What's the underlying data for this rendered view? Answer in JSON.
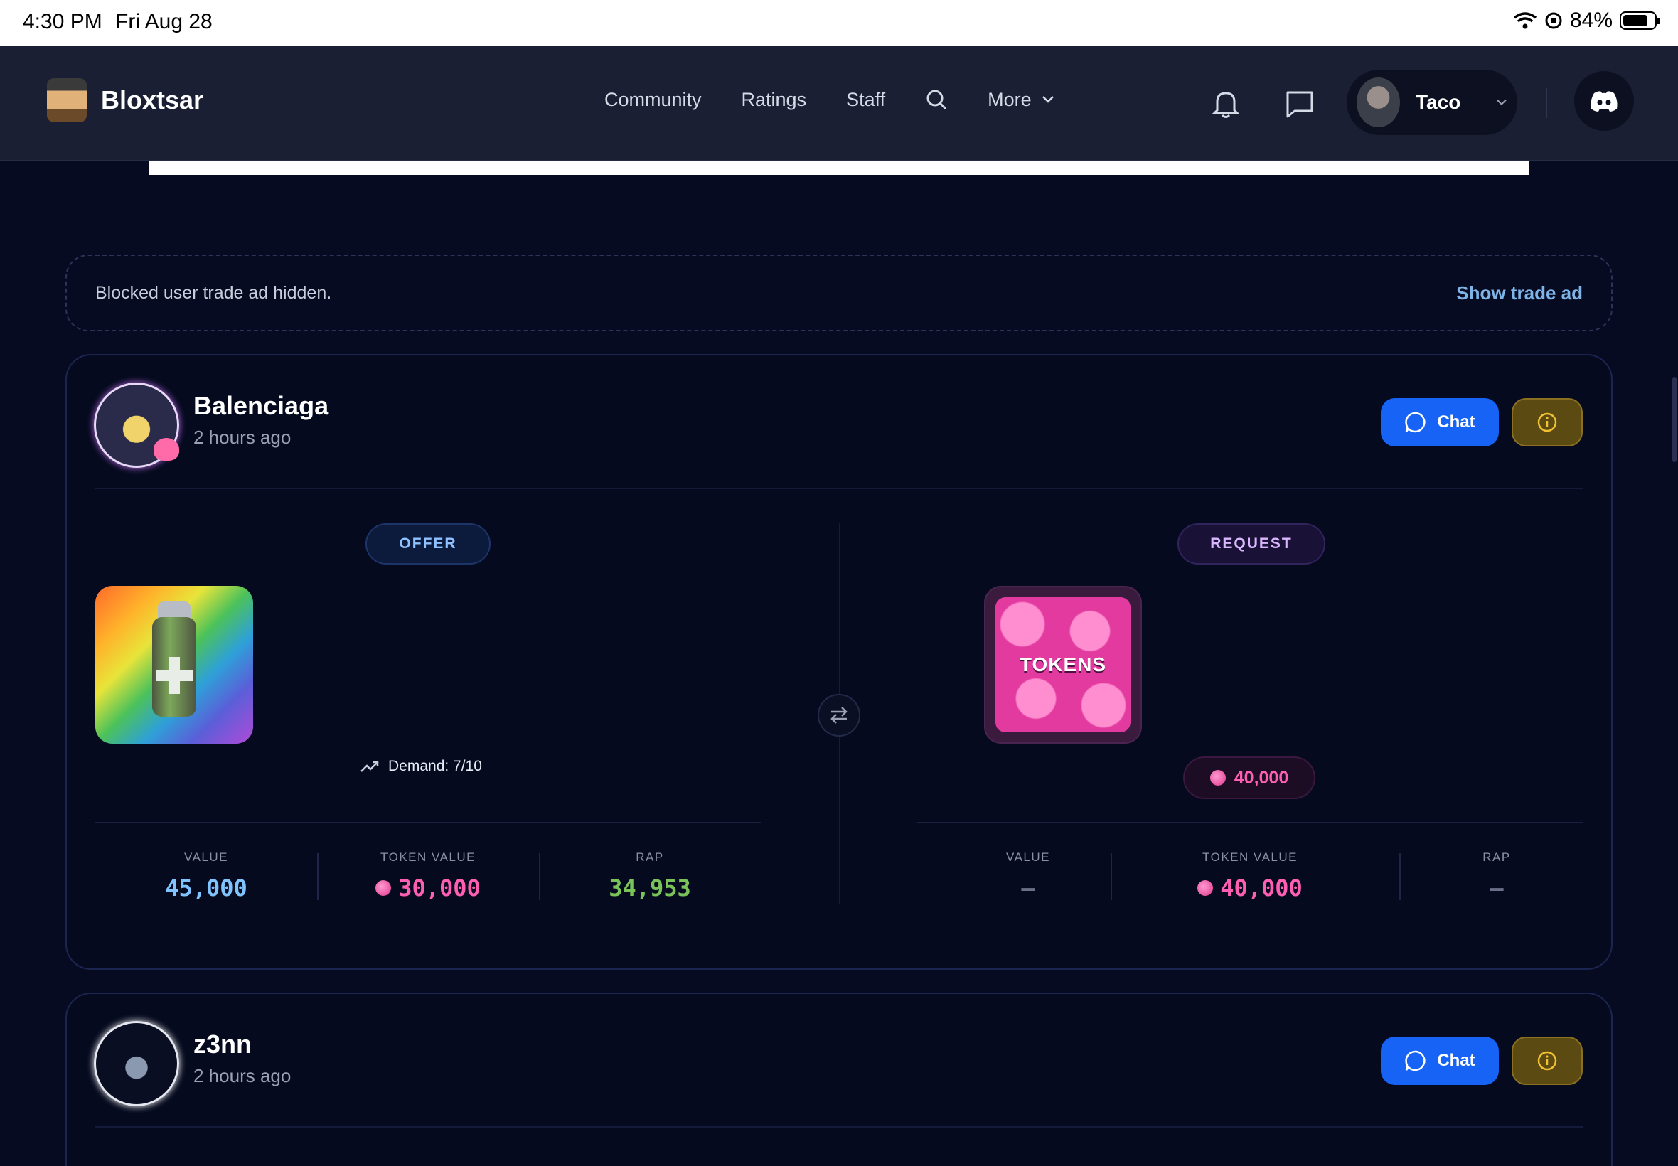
{
  "status_bar": {
    "time": "4:30 PM",
    "date": "Fri Aug 28",
    "battery": "84%"
  },
  "nav": {
    "brand": "Bloxtsar",
    "links": [
      "Community",
      "Ratings",
      "Staff"
    ],
    "more": "More",
    "user": "Taco"
  },
  "blocked": {
    "message": "Blocked user trade ad hidden.",
    "action": "Show trade ad"
  },
  "trades": [
    {
      "user": "Balenciaga",
      "time": "2 hours ago",
      "chat": "Chat",
      "offer": {
        "label": "OFFER",
        "demand": "Demand: 7/10",
        "stats": {
          "value_label": "VALUE",
          "value": "45,000",
          "token_label": "TOKEN VALUE",
          "token": "30,000",
          "rap_label": "RAP",
          "rap": "34,953"
        }
      },
      "request": {
        "label": "REQUEST",
        "item_text": "TOKENS",
        "amount": "40,000",
        "stats": {
          "value_label": "VALUE",
          "value": "–",
          "token_label": "TOKEN VALUE",
          "token": "40,000",
          "rap_label": "RAP",
          "rap": "–"
        }
      }
    },
    {
      "user": "z3nn",
      "time": "2 hours ago",
      "chat": "Chat"
    }
  ],
  "colors": {
    "accent_blue": "#1663f5",
    "value_blue": "#7fc4ff",
    "token_pink": "#ff5fb2",
    "rap_green": "#79c35a",
    "info_gold": "#5b4a12"
  }
}
